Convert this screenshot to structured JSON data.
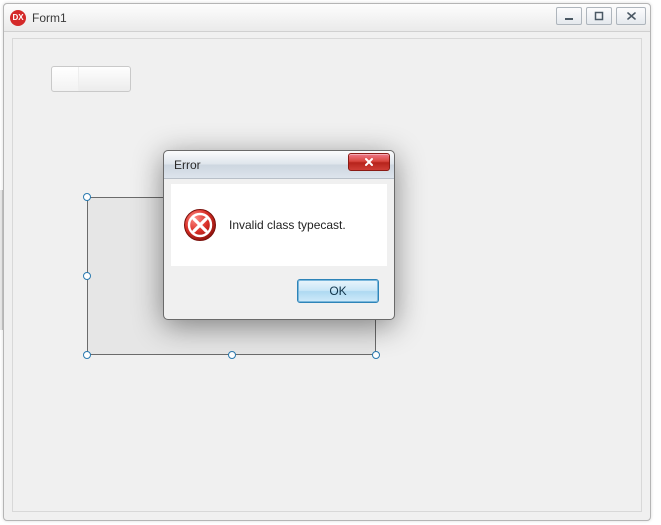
{
  "main_window": {
    "title": "Form1",
    "app_icon_label": "DX"
  },
  "dialog": {
    "title": "Error",
    "message": "Invalid class typecast.",
    "ok_label": "OK"
  }
}
